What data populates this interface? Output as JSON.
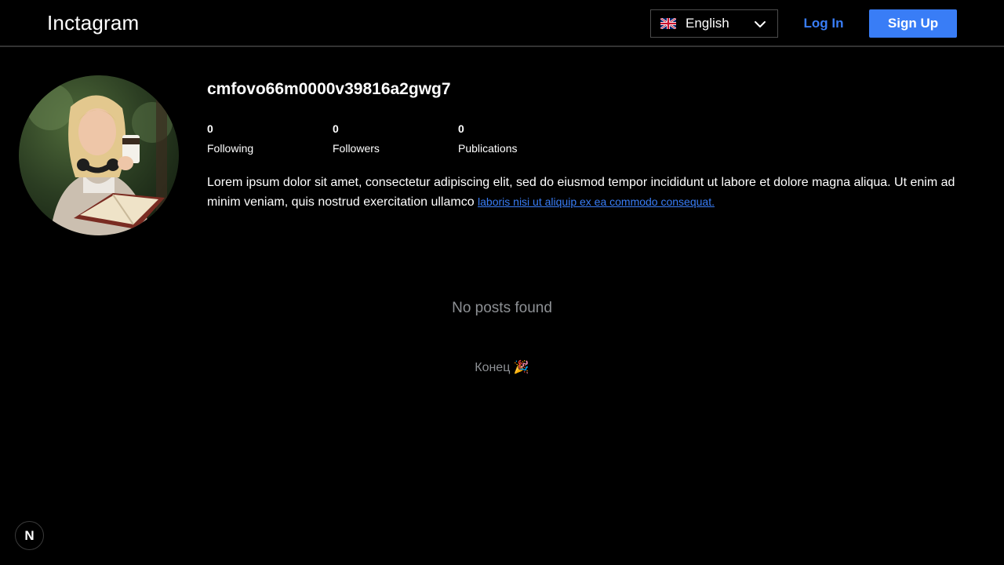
{
  "header": {
    "logo": "Inctagram",
    "language": {
      "selected": "English",
      "flag_icon": "uk-flag-icon",
      "chevron_icon": "chevron-down-icon"
    },
    "login_label": "Log In",
    "signup_label": "Sign Up"
  },
  "profile": {
    "username": "cmfovo66m0000v39816a2gwg7",
    "stats": [
      {
        "value": "0",
        "label": "Following"
      },
      {
        "value": "0",
        "label": "Followers"
      },
      {
        "value": "0",
        "label": "Publications"
      }
    ],
    "bio_text": "Lorem ipsum dolor sit amet, consectetur adipiscing elit, sed do eiusmod tempor incididunt ut labore et dolore magna aliqua. Ut enim ad minim veniam, quis nostrud exercitation ullamco ",
    "bio_link": "laboris nisi ut aliquip ex ea commodo consequat."
  },
  "posts": {
    "empty_message": "No posts found",
    "end_message": "Конец 🎉"
  },
  "dev_badge": "N",
  "colors": {
    "accent": "#397df6",
    "background": "#000000",
    "muted_text": "#8d9094"
  }
}
